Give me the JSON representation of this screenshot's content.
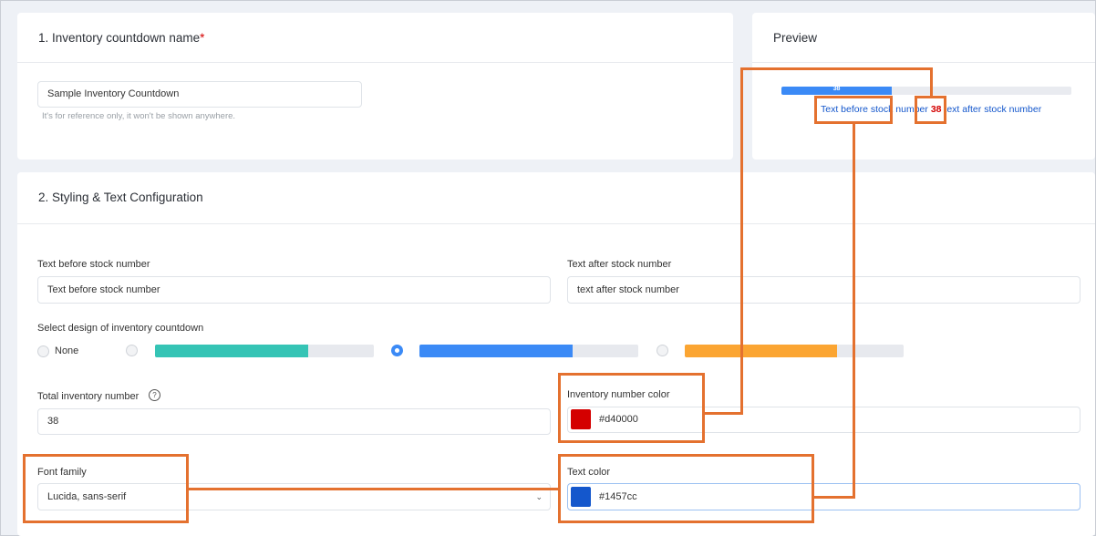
{
  "section1": {
    "title": "1. Inventory countdown name",
    "required_mark": "*",
    "name_value": "Sample Inventory Countdown",
    "helper": "It's for reference only, it won't be shown anywhere."
  },
  "preview": {
    "title": "Preview",
    "bar_number": "38",
    "bar_fill_fraction": 0.38,
    "text_before": "Text before stock number",
    "number": "38",
    "text_after": "text after stock number"
  },
  "section2": {
    "title": "2. Styling & Text Configuration",
    "text_before_label": "Text before stock number",
    "text_before_value": "Text before stock number",
    "text_after_label": "Text after stock number",
    "text_after_value": "text after stock number",
    "design_label": "Select design of inventory countdown",
    "design_none_label": "None",
    "total_label": "Total inventory number",
    "total_value": "38",
    "help_icon": "?",
    "number_color_label": "Inventory number color",
    "number_color_value": "#d40000",
    "font_label": "Font family",
    "font_value": "Lucida, sans-serif",
    "text_color_label": "Text color",
    "text_color_value": "#1457cc"
  },
  "colors": {
    "number_color": "#d40000",
    "text_color": "#1457cc",
    "design_teal": "#35c4b5",
    "design_blue": "#3b8af6",
    "design_orange": "#fba532",
    "highlight": "#e4712f"
  }
}
